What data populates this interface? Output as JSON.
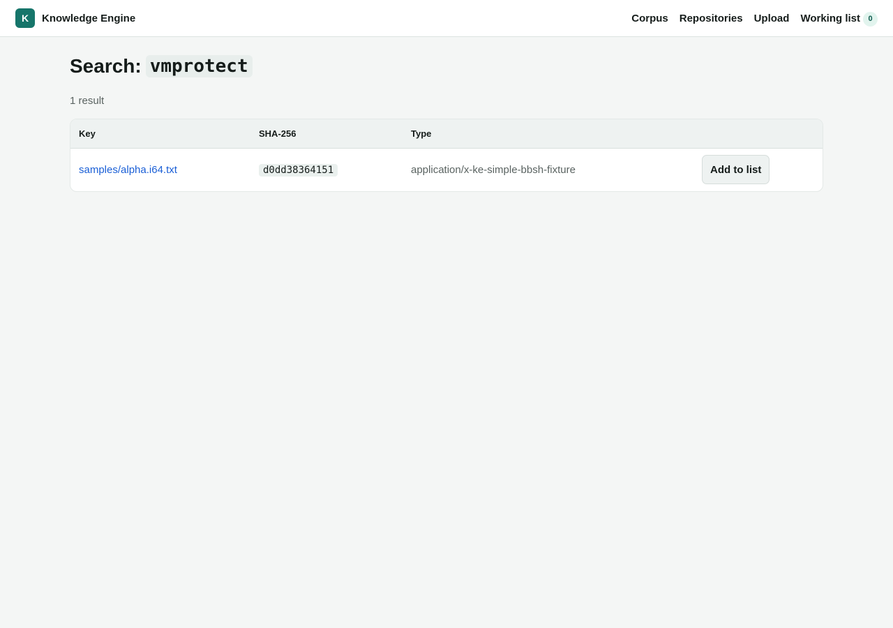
{
  "header": {
    "logo_letter": "K",
    "app_name": "Knowledge Engine",
    "nav": {
      "corpus": "Corpus",
      "repositories": "Repositories",
      "upload": "Upload",
      "working_list": "Working list",
      "working_list_count": "0"
    }
  },
  "search": {
    "title_prefix": "Search:",
    "query": "vmprotect",
    "result_count": "1 result"
  },
  "table": {
    "columns": {
      "key": "Key",
      "sha": "SHA-256",
      "type": "Type",
      "action": ""
    },
    "rows": [
      {
        "key": "samples/alpha.i64.txt",
        "sha": "d0dd38364151",
        "type": "application/x-ke-simple-bbsh-fixture",
        "action_label": "Add to list"
      }
    ]
  },
  "colors": {
    "brand": "#16756a",
    "link": "#1a5fd6",
    "background": "#f4f6f5"
  }
}
